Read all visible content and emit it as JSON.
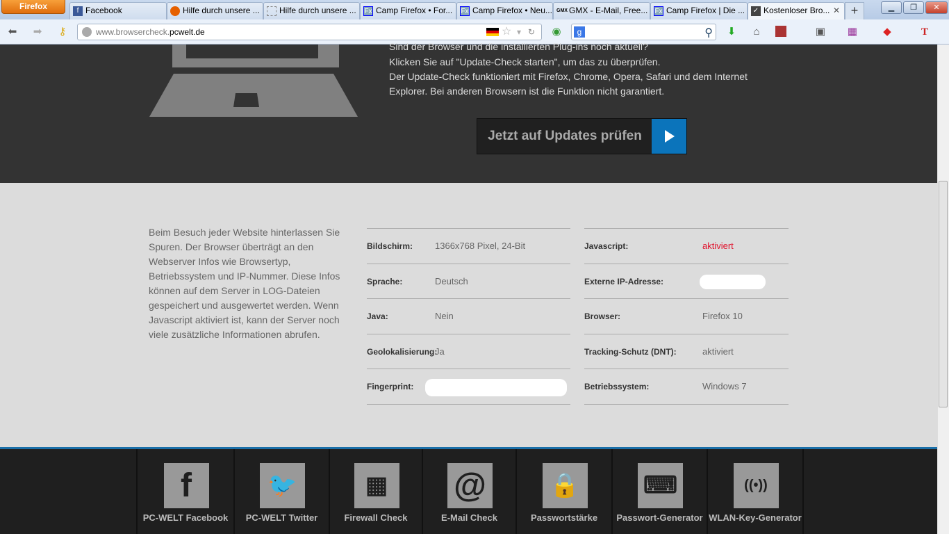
{
  "browser": {
    "menu_label": "Firefox",
    "tabs": [
      {
        "label": "Facebook",
        "icon": "f"
      },
      {
        "label": "Hilfe durch unsere ...",
        "icon": "firefox"
      },
      {
        "label": "Hilfe durch unsere ...",
        "icon": "blank"
      },
      {
        "label": "Camp Firefox • For...",
        "icon": "Fx"
      },
      {
        "label": "Camp Firefox • Neu...",
        "icon": "Fx"
      },
      {
        "label": "GMX - E-Mail, Free...",
        "icon": "GMX"
      },
      {
        "label": "Camp Firefox | Die ...",
        "icon": "Fx"
      },
      {
        "label": "Kostenloser Bro...",
        "icon": "check"
      }
    ],
    "url_prefix": "www.browsercheck.",
    "url_domain": "pcwelt.de",
    "search_engine": "g"
  },
  "hero": {
    "lines": [
      "Sind der Browser und die installierten Plug-ins noch aktuell?",
      "Klicken Sie auf \"Update-Check starten\", um das zu überprüfen.",
      "Der Update-Check funktioniert mit Firefox, Chrome, Opera, Safari und dem Internet",
      "Explorer. Bei anderen Browsern ist die Funktion nicht garantiert."
    ],
    "button": "Jetzt auf Updates prüfen"
  },
  "info": {
    "description": "Beim Besuch jeder Website hinterlassen Sie Spuren. Der Browser überträgt an den Webserver Infos wie Browsertyp, Betriebssystem und IP-Nummer. Diese Infos können auf dem Server in LOG-Dateien gespeichert und ausgewertet werden. Wenn Javascript aktiviert ist, kann der Server noch viele zusätzliche Informationen abrufen.",
    "left": [
      {
        "label": "Bildschirm:",
        "value": "1366x768 Pixel, 24-Bit"
      },
      {
        "label": "Sprache:",
        "value": "Deutsch"
      },
      {
        "label": "Java:",
        "value": "Nein"
      },
      {
        "label": "Geolokalisierung:",
        "value": "Ja"
      },
      {
        "label": "Fingerprint:",
        "value": ""
      }
    ],
    "right": [
      {
        "label": "Javascript:",
        "value": "aktiviert"
      },
      {
        "label": "Externe IP-Adresse:",
        "value": ""
      },
      {
        "label": "Browser:",
        "value": "Firefox 10"
      },
      {
        "label": "Tracking-Schutz (DNT):",
        "value": "aktiviert"
      },
      {
        "label": "Betriebssystem:",
        "value": "Windows 7"
      }
    ],
    "accent_red": "#e0132d"
  },
  "footer": {
    "tiles": [
      {
        "label": "PC-WELT Facebook",
        "icon": "facebook"
      },
      {
        "label": "PC-WELT Twitter",
        "icon": "twitter"
      },
      {
        "label": "Firewall Check",
        "icon": "firewall"
      },
      {
        "label": "E-Mail Check",
        "icon": "at"
      },
      {
        "label": "Passwortstärke",
        "icon": "lock"
      },
      {
        "label": "Passwort-Generator",
        "icon": "password"
      },
      {
        "label": "WLAN-Key-Generator",
        "icon": "wifi"
      }
    ]
  }
}
